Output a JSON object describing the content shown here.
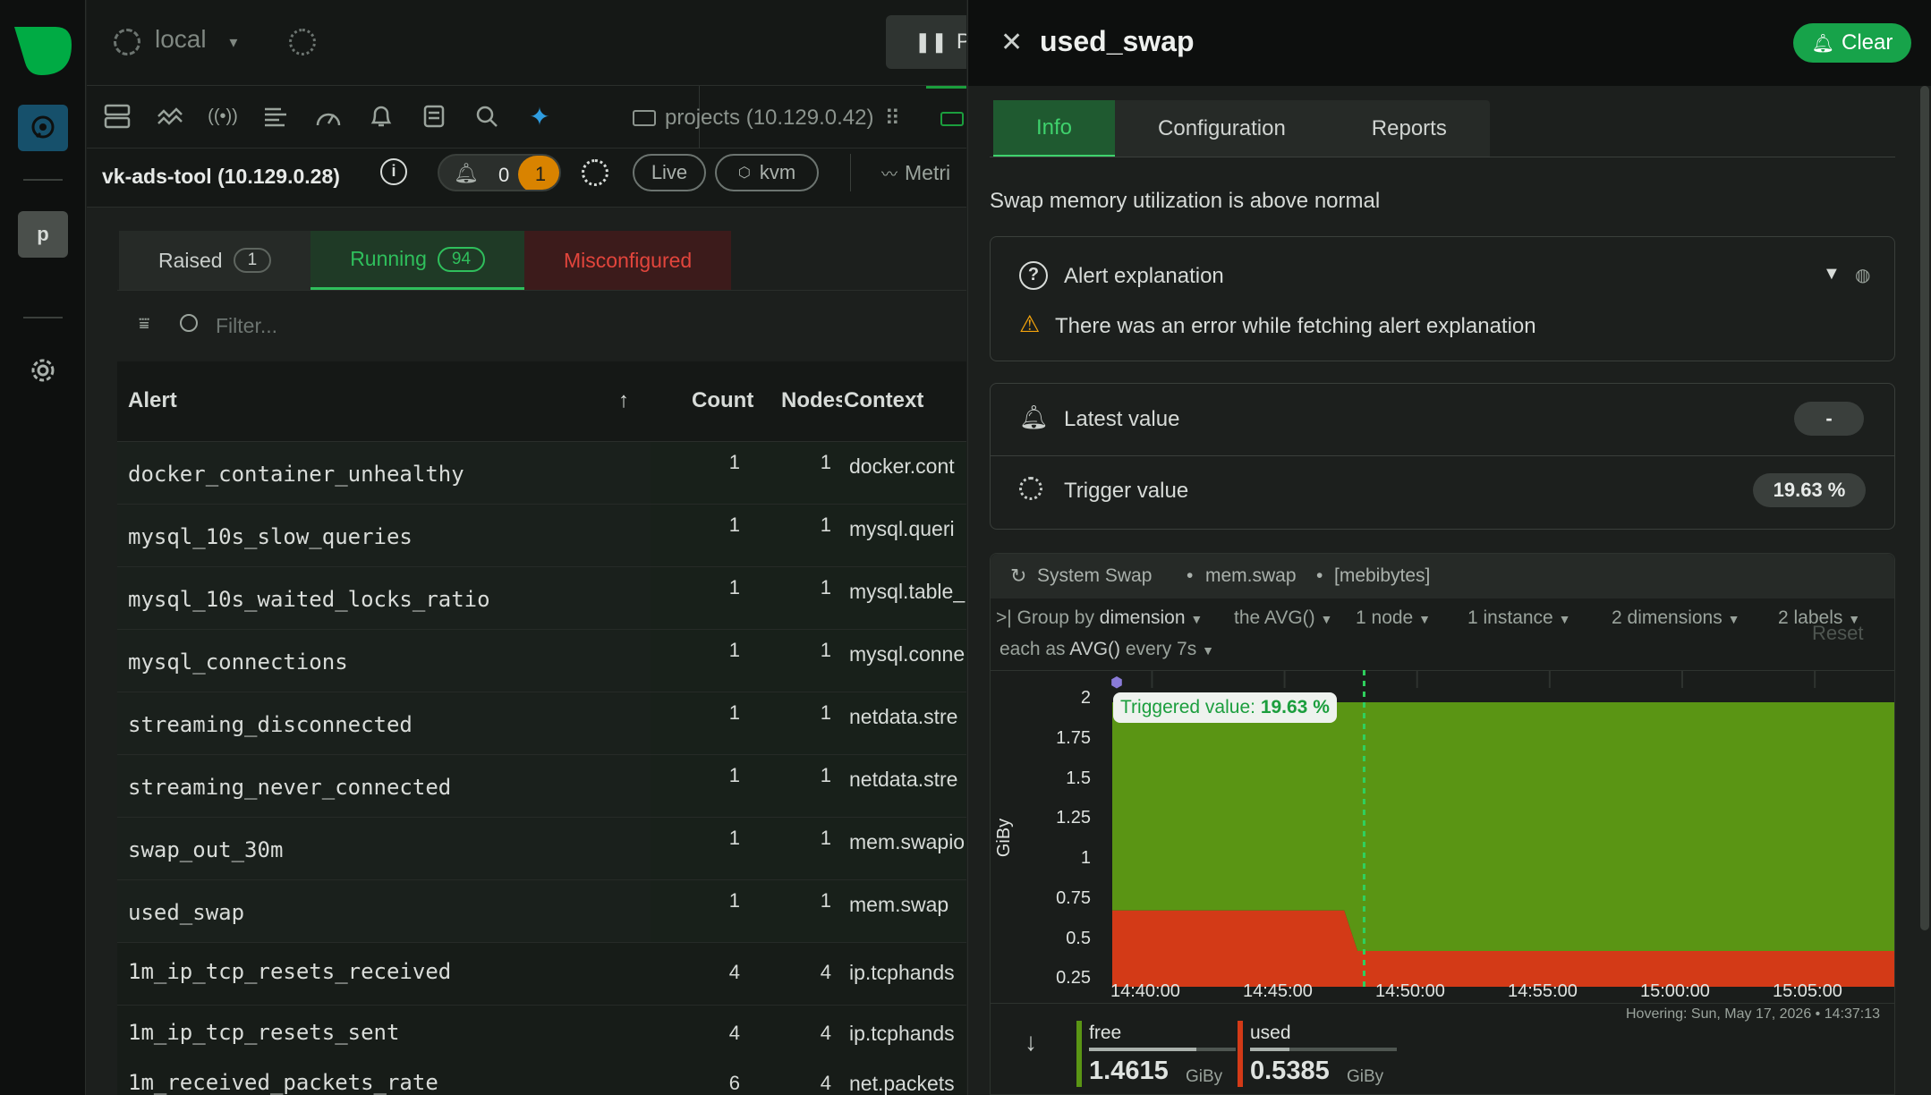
{
  "topbar": {
    "space": "local",
    "pause_label": "Pa"
  },
  "toolbar": {
    "room_label": "projects (10.129.0.42)"
  },
  "nodebar": {
    "node_label": "vk-ads-tool (10.129.0.28)",
    "alert_count_a": "0",
    "alert_count_b": "1",
    "live_label": "Live",
    "kvm_label": "kvm",
    "metrics_label": "Metri"
  },
  "rail": {
    "avatar_letter": "p"
  },
  "alert_tabs": [
    {
      "label": "Raised",
      "count": "1"
    },
    {
      "label": "Running",
      "count": "94"
    },
    {
      "label": "Misconfigured"
    }
  ],
  "filter": {
    "placeholder": "Filter..."
  },
  "table": {
    "headers": {
      "alert": "Alert",
      "sort": "↑",
      "count": "Count",
      "nodes": "Nodes",
      "context": "Context"
    },
    "rows": [
      {
        "name": "docker_container_unhealthy",
        "count": "1",
        "nodes": "1",
        "context": "docker.cont"
      },
      {
        "name": "mysql_10s_slow_queries",
        "count": "1",
        "nodes": "1",
        "context": "mysql.queri"
      },
      {
        "name": "mysql_10s_waited_locks_ratio",
        "count": "1",
        "nodes": "1",
        "context": "mysql.table_"
      },
      {
        "name": "mysql_connections",
        "count": "1",
        "nodes": "1",
        "context": "mysql.conne"
      },
      {
        "name": "streaming_disconnected",
        "count": "1",
        "nodes": "1",
        "context": "netdata.stre"
      },
      {
        "name": "streaming_never_connected",
        "count": "1",
        "nodes": "1",
        "context": "netdata.stre"
      },
      {
        "name": "swap_out_30m",
        "count": "1",
        "nodes": "1",
        "context": "mem.swapio"
      },
      {
        "name": "used_swap",
        "count": "1",
        "nodes": "1",
        "context": "mem.swap"
      },
      {
        "name": "1m_ip_tcp_resets_received",
        "count": "4",
        "nodes": "4",
        "context": "ip.tcphands"
      },
      {
        "name": "1m_ip_tcp_resets_sent",
        "count": "4",
        "nodes": "4",
        "context": "ip.tcphands"
      },
      {
        "name": "1m_received_packets_rate",
        "count": "6",
        "nodes": "4",
        "context": "net.packets"
      }
    ]
  },
  "panel": {
    "title": "used_swap",
    "clear_label": "Clear",
    "tabs": [
      "Info",
      "Configuration",
      "Reports"
    ],
    "summary": "Swap memory utilization is above normal",
    "explanation_title": "Alert explanation",
    "explanation_error": "There was an error while fetching alert explanation",
    "latest_label": "Latest value",
    "latest_value": "-",
    "trigger_label": "Trigger value",
    "trigger_value": "19.63 %"
  },
  "chart_controls": {
    "title": "System Swap",
    "context": "mem.swap",
    "units": "[mebibytes]",
    "group_by": "Group by",
    "dimension": "dimension",
    "agg": "the AVG()",
    "nodes": "1 node",
    "instances": "1 instance",
    "dimensions": "2 dimensions",
    "labels": "2 labels",
    "reset": "Reset",
    "each_as": "each as",
    "each_agg": "AVG()",
    "every": "every 7s",
    "triggered_label": "Triggered value:",
    "triggered_value": "19.63 %",
    "hovering": "Hovering:  Sun, May 17, 2026 • 14:37:13"
  },
  "colors": {
    "free": "#5a9514",
    "used": "#d33a17",
    "accent": "#1b9e3d"
  },
  "chart_data": {
    "type": "area",
    "ylabel": "GiBy",
    "yticks": [
      "2",
      "1.75",
      "1.5",
      "1.25",
      "1",
      "0.75",
      "0.5",
      "0.25"
    ],
    "xticks": [
      "14:40:00",
      "14:45:00",
      "14:50:00",
      "14:55:00",
      "15:00:00",
      "15:05:00"
    ],
    "ylim": [
      0.25,
      2
    ],
    "stacked": true,
    "series": [
      {
        "name": "used",
        "x": [
          "14:38:30",
          "14:47:15",
          "14:47:45",
          "15:08:00"
        ],
        "values": [
          0.66,
          0.66,
          0.4,
          0.4
        ]
      },
      {
        "name": "free",
        "x": [
          "14:38:30",
          "14:47:15",
          "14:47:45",
          "15:08:00"
        ],
        "values": [
          1.34,
          1.34,
          1.6,
          1.6
        ]
      }
    ],
    "trigger_time": "14:48:00"
  },
  "legend": [
    {
      "name": "free",
      "value": "1.4615",
      "unit": "GiBy"
    },
    {
      "name": "used",
      "value": "0.5385",
      "unit": "GiBy"
    }
  ]
}
